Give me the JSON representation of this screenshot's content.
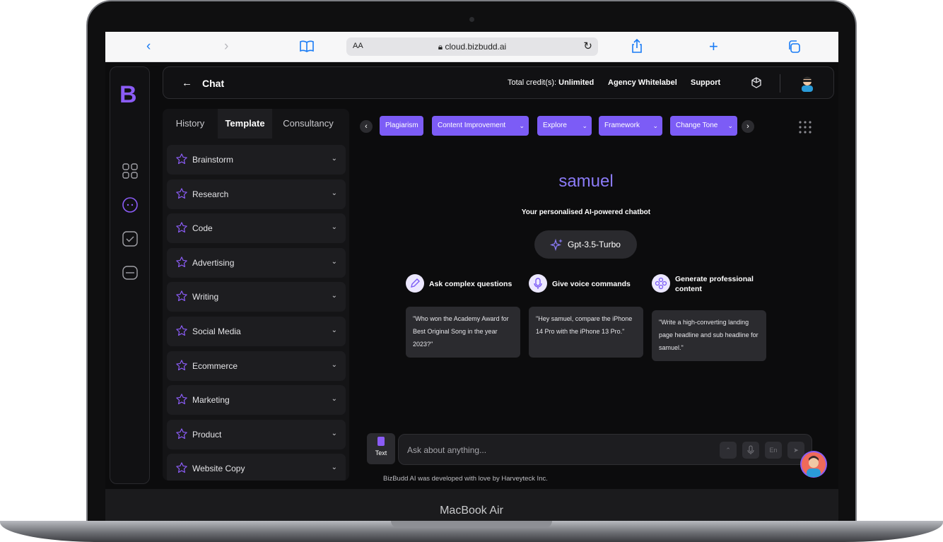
{
  "device": {
    "label": "MacBook Air"
  },
  "browser": {
    "aa_label": "AA",
    "url": "cloud.bizbudd.ai"
  },
  "app": {
    "logo": "B",
    "header": {
      "back_arrow": "←",
      "title": "Chat",
      "credits_label": "Total credit(s):",
      "credits_value": "Unlimited",
      "link_whitelabel": "Agency Whitelabel",
      "link_support": "Support"
    },
    "tabs": [
      "History",
      "Template",
      "Consultancy"
    ],
    "active_tab": "Template",
    "categories": [
      "Brainstorm",
      "Research",
      "Code",
      "Advertising",
      "Writing",
      "Social Media",
      "Ecommerce",
      "Marketing",
      "Product",
      "Website Copy"
    ],
    "chips": [
      "Plagiarism",
      "Content Improvement",
      "Explore",
      "Framework",
      "Change Tone"
    ],
    "bot": {
      "name": "samuel",
      "subtitle": "Your personalised AI-powered chatbot",
      "model": "Gpt-3.5-Turbo"
    },
    "features": [
      {
        "title": "Ask complex questions",
        "example": "\"Who won the Academy Award for Best Original Song in the year 2023?\""
      },
      {
        "title": "Give voice commands",
        "example": "\"Hey samuel, compare the iPhone 14 Pro with the iPhone 13 Pro.\""
      },
      {
        "title": "Generate professional content",
        "example": "\"Write a high-converting landing page headline and sub headline for samuel.\""
      }
    ],
    "input": {
      "text_button": "Text",
      "placeholder": "Ask about anything...",
      "lang_button": "En"
    },
    "footer": "BizBudd AI was developed with love by Harveyteck Inc.",
    "accent_color": "#7c5cf6"
  }
}
